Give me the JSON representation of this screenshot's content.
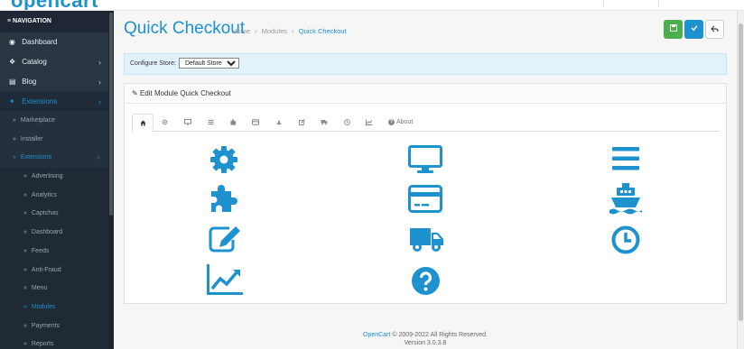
{
  "app": {
    "logo": "opencart",
    "brand_color": "#1e91cf"
  },
  "sidebar": {
    "header": "NAVIGATION",
    "items": [
      {
        "label": "Dashboard",
        "icon": "dashboard-icon"
      },
      {
        "label": "Catalog",
        "icon": "tag-icon"
      },
      {
        "label": "Blog",
        "icon": "newspaper-icon"
      },
      {
        "label": "Extensions",
        "icon": "puzzle-icon"
      }
    ],
    "extensions_sub": [
      {
        "label": "Marketplace"
      },
      {
        "label": "Installer"
      },
      {
        "label": "Extensions"
      }
    ],
    "extensions_sub2": [
      {
        "label": "Advertising"
      },
      {
        "label": "Analytics"
      },
      {
        "label": "Captchas"
      },
      {
        "label": "Dashboard"
      },
      {
        "label": "Feeds"
      },
      {
        "label": "Anti-Fraud"
      },
      {
        "label": "Menu"
      },
      {
        "label": "Modules"
      },
      {
        "label": "Payments"
      },
      {
        "label": "Reports"
      }
    ]
  },
  "header": {
    "title": "Quick Checkout",
    "breadcrumb": [
      "Home",
      "Modules",
      "Quick Checkout"
    ],
    "breadcrumb_sep": "›"
  },
  "store": {
    "label": "Configure Store:",
    "selected": "Default Store"
  },
  "panel": {
    "title": "Edit Module Quick Checkout",
    "about_tab": "About"
  },
  "footer": {
    "link": "OpenCart",
    "copyright": "© 2009-2022 All Rights Reserved.",
    "version": "Version 3.0.3.8"
  }
}
